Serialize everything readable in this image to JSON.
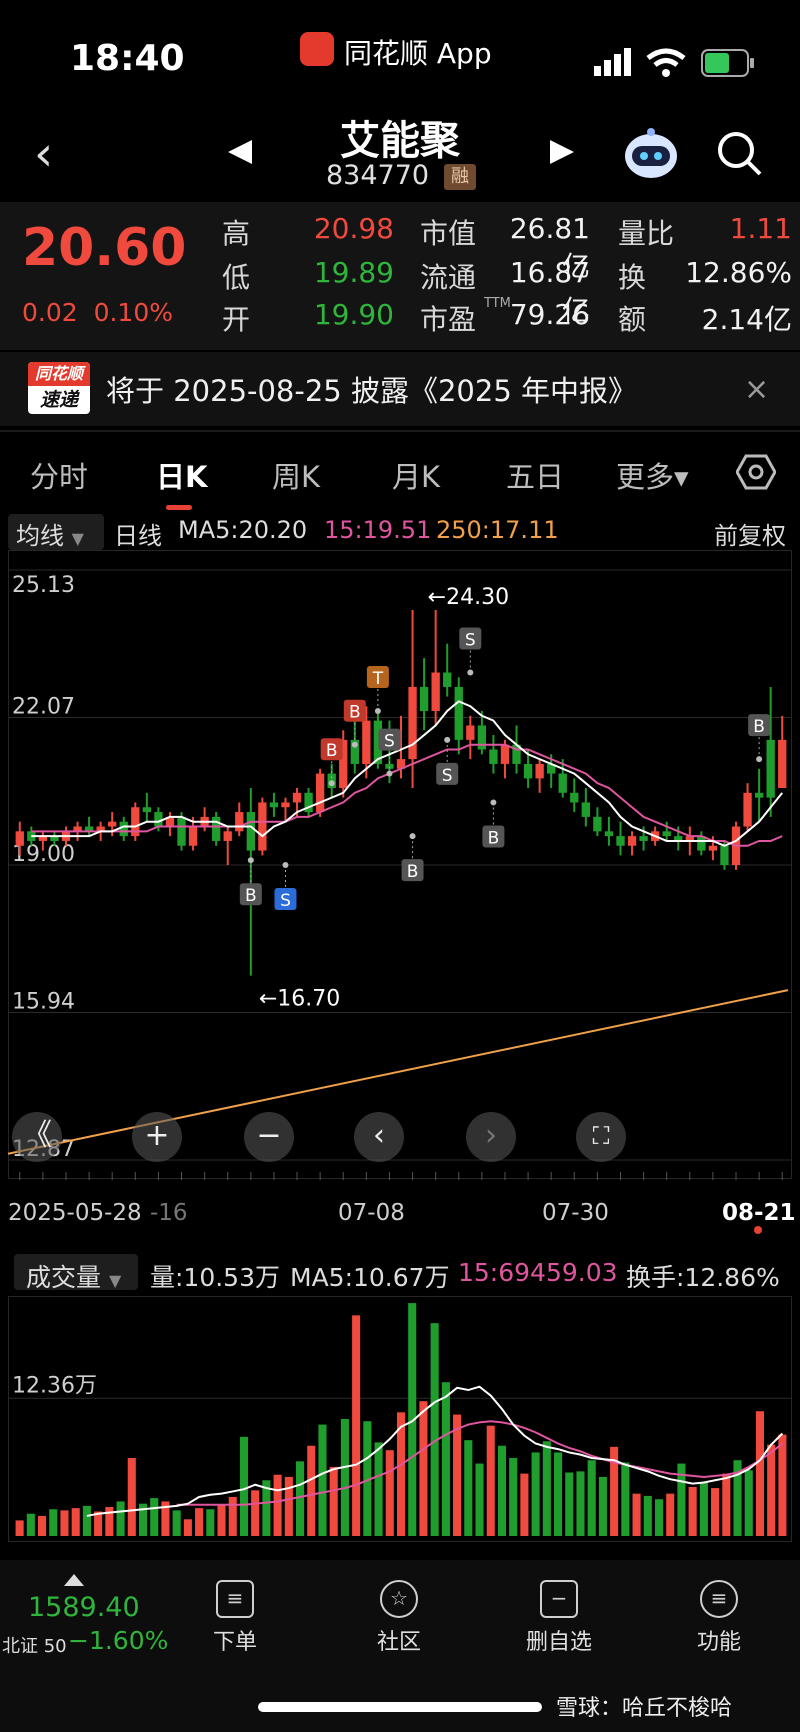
{
  "status_bar": {
    "time": "18:40",
    "app_label": "同花顺 App"
  },
  "header": {
    "name": "艾能聚",
    "code": "834770",
    "margin_badge": "融"
  },
  "quote": {
    "price": "20.60",
    "change": "0.02",
    "change_pct": "0.10%",
    "rows": [
      {
        "l1": "高",
        "v1": "20.98",
        "c1": "red",
        "l2": "市值",
        "v2": "26.81亿",
        "l3": "量比",
        "v3": "1.11",
        "c3": "red"
      },
      {
        "l1": "低",
        "v1": "19.89",
        "c1": "green",
        "l2": "流通",
        "v2": "16.87亿",
        "l3": "换",
        "v3": "12.86%",
        "c3": "white"
      },
      {
        "l1": "开",
        "v1": "19.90",
        "c1": "green",
        "l2": "市盈",
        "v2": "79.26",
        "l3": "额",
        "v3": "2.14亿",
        "c3": "white"
      }
    ],
    "pe_superscript": "TTM"
  },
  "notice": {
    "logo_top": "同花顺",
    "logo_bottom": "速递",
    "text": "将于 2025-08-25 披露《2025 年中报》",
    "close": "×"
  },
  "tabs": [
    "分时",
    "日K",
    "周K",
    "月K",
    "五日",
    "更多▾"
  ],
  "active_tab": "日K",
  "ma_bar": {
    "selector": "均线",
    "period": "日线",
    "ma5": "MA5:20.20",
    "ma15": "15:19.51",
    "ma250": "250:17.11",
    "adjust": "前复权"
  },
  "price_axis": [
    "25.13",
    "22.07",
    "19.00",
    "15.94",
    "12.87"
  ],
  "annotations": {
    "high": "←24.30",
    "low": "←16.70"
  },
  "dates": {
    "start": "2025-05-28",
    "partial": "-16",
    "d1": "07-08",
    "d2": "07-30",
    "end": "08-21"
  },
  "zoom_controls": [
    "《",
    "+",
    "−",
    "‹",
    "›",
    "⛶"
  ],
  "volume_bar": {
    "selector": "成交量",
    "vol": "量:10.53万",
    "ma5": "MA5:10.67万",
    "ma15": "15:69459.03",
    "turnover": "换手:12.86%"
  },
  "volume_axis": "12.36万",
  "colors": {
    "up": "#f04a3e",
    "down": "#1f9e2e",
    "ma5": "#ffffff",
    "ma15": "#e0559f",
    "ma250": "#f0a14a"
  },
  "chart_data": {
    "type": "candlestick",
    "ylim": [
      12.87,
      25.13
    ],
    "candles": [
      [
        19.4,
        19.9,
        19.2,
        19.7,
        "up"
      ],
      [
        19.7,
        19.8,
        19.4,
        19.5,
        "down"
      ],
      [
        19.5,
        19.7,
        19.3,
        19.6,
        "up"
      ],
      [
        19.6,
        19.7,
        19.4,
        19.5,
        "down"
      ],
      [
        19.5,
        19.8,
        19.4,
        19.7,
        "up"
      ],
      [
        19.7,
        19.9,
        19.5,
        19.8,
        "up"
      ],
      [
        19.8,
        20.0,
        19.6,
        19.7,
        "down"
      ],
      [
        19.7,
        19.9,
        19.5,
        19.8,
        "up"
      ],
      [
        19.8,
        20.1,
        19.6,
        19.9,
        "up"
      ],
      [
        19.9,
        20.0,
        19.5,
        19.6,
        "down"
      ],
      [
        19.6,
        20.3,
        19.5,
        20.2,
        "up"
      ],
      [
        20.2,
        20.5,
        19.9,
        20.1,
        "down"
      ],
      [
        20.1,
        20.2,
        19.7,
        19.8,
        "down"
      ],
      [
        19.8,
        20.1,
        19.6,
        20.0,
        "up"
      ],
      [
        20.0,
        20.1,
        19.3,
        19.4,
        "down"
      ],
      [
        19.4,
        20.0,
        19.3,
        19.8,
        "up"
      ],
      [
        19.8,
        20.2,
        19.7,
        20.0,
        "up"
      ],
      [
        20.0,
        20.1,
        19.4,
        19.5,
        "down"
      ],
      [
        19.5,
        19.8,
        19.0,
        19.7,
        "up"
      ],
      [
        19.7,
        20.3,
        19.6,
        20.1,
        "up"
      ],
      [
        20.1,
        20.6,
        16.7,
        19.3,
        "down"
      ],
      [
        19.3,
        20.4,
        19.2,
        20.3,
        "up"
      ],
      [
        20.3,
        20.5,
        20.0,
        20.2,
        "down"
      ],
      [
        20.2,
        20.4,
        19.9,
        20.3,
        "up"
      ],
      [
        20.3,
        20.6,
        20.0,
        20.5,
        "up"
      ],
      [
        20.5,
        20.6,
        20.0,
        20.1,
        "down"
      ],
      [
        20.1,
        21.0,
        20.0,
        20.9,
        "up"
      ],
      [
        20.9,
        21.1,
        20.4,
        20.6,
        "down"
      ],
      [
        20.6,
        21.8,
        20.4,
        21.6,
        "up"
      ],
      [
        21.6,
        22.4,
        20.9,
        21.1,
        "down"
      ],
      [
        21.1,
        22.3,
        20.8,
        22.0,
        "up"
      ],
      [
        22.0,
        22.2,
        21.0,
        21.1,
        "down"
      ],
      [
        21.1,
        22.0,
        20.7,
        21.0,
        "down"
      ],
      [
        21.0,
        22.1,
        20.8,
        21.2,
        "up"
      ],
      [
        21.2,
        24.3,
        20.6,
        22.7,
        "up"
      ],
      [
        22.7,
        23.3,
        21.8,
        22.2,
        "down"
      ],
      [
        22.2,
        24.3,
        21.9,
        23.0,
        "up"
      ],
      [
        23.0,
        23.6,
        22.5,
        22.7,
        "down"
      ],
      [
        22.7,
        22.9,
        21.3,
        21.6,
        "down"
      ],
      [
        21.6,
        22.1,
        21.2,
        21.9,
        "up"
      ],
      [
        21.9,
        22.2,
        21.3,
        21.4,
        "down"
      ],
      [
        21.4,
        21.7,
        20.9,
        21.1,
        "down"
      ],
      [
        21.1,
        21.6,
        20.8,
        21.5,
        "up"
      ],
      [
        21.5,
        21.9,
        20.9,
        21.1,
        "down"
      ],
      [
        21.1,
        21.4,
        20.6,
        20.8,
        "down"
      ],
      [
        20.8,
        21.2,
        20.5,
        21.1,
        "up"
      ],
      [
        21.1,
        21.3,
        20.6,
        20.9,
        "down"
      ],
      [
        20.9,
        21.2,
        20.4,
        20.5,
        "down"
      ],
      [
        20.5,
        20.8,
        20.1,
        20.3,
        "down"
      ],
      [
        20.3,
        20.6,
        19.8,
        20.0,
        "down"
      ],
      [
        20.0,
        20.2,
        19.6,
        19.7,
        "down"
      ],
      [
        19.7,
        20.0,
        19.4,
        19.6,
        "down"
      ],
      [
        19.6,
        19.9,
        19.2,
        19.4,
        "down"
      ],
      [
        19.4,
        19.7,
        19.2,
        19.6,
        "up"
      ],
      [
        19.6,
        19.8,
        19.3,
        19.5,
        "down"
      ],
      [
        19.5,
        19.8,
        19.4,
        19.7,
        "up"
      ],
      [
        19.7,
        19.9,
        19.5,
        19.6,
        "down"
      ],
      [
        19.6,
        19.8,
        19.3,
        19.5,
        "down"
      ],
      [
        19.5,
        19.8,
        19.2,
        19.6,
        "up"
      ],
      [
        19.6,
        19.7,
        19.2,
        19.3,
        "down"
      ],
      [
        19.3,
        19.6,
        19.1,
        19.4,
        "up"
      ],
      [
        19.4,
        19.5,
        18.9,
        19.0,
        "down"
      ],
      [
        19.0,
        19.9,
        18.9,
        19.8,
        "up"
      ],
      [
        19.8,
        20.7,
        19.7,
        20.5,
        "up"
      ],
      [
        20.5,
        21.0,
        19.9,
        20.4,
        "down"
      ],
      [
        20.4,
        22.7,
        20.0,
        21.6,
        "down"
      ],
      [
        21.6,
        22.1,
        20.7,
        20.6,
        "up"
      ]
    ],
    "ma5": [
      19.6,
      19.6,
      19.6,
      19.6,
      19.6,
      19.6,
      19.7,
      19.7,
      19.8,
      19.8,
      19.9,
      19.9,
      20.0,
      20.0,
      19.9,
      19.9,
      19.9,
      19.8,
      19.8,
      19.8,
      19.6,
      19.8,
      19.9,
      20.1,
      20.2,
      20.3,
      20.4,
      20.5,
      20.8,
      21.0,
      21.2,
      21.3,
      21.4,
      21.5,
      21.7,
      21.9,
      22.2,
      22.4,
      22.3,
      22.1,
      22.0,
      21.7,
      21.5,
      21.3,
      21.2,
      21.1,
      21.0,
      20.9,
      20.7,
      20.5,
      20.3,
      20.0,
      19.8,
      19.7,
      19.6,
      19.5,
      19.5,
      19.5,
      19.5,
      19.5,
      19.4,
      19.5,
      19.7,
      19.9,
      20.2,
      20.5
    ],
    "ma15": [
      19.7,
      19.7,
      19.7,
      19.7,
      19.7,
      19.7,
      19.7,
      19.7,
      19.7,
      19.7,
      19.7,
      19.8,
      19.8,
      19.8,
      19.8,
      19.8,
      19.8,
      19.8,
      19.8,
      19.9,
      19.9,
      19.9,
      19.9,
      20.0,
      20.0,
      20.1,
      20.2,
      20.3,
      20.5,
      20.6,
      20.8,
      20.9,
      21.0,
      21.1,
      21.2,
      21.3,
      21.4,
      21.4,
      21.5,
      21.5,
      21.5,
      21.5,
      21.4,
      21.4,
      21.3,
      21.2,
      21.1,
      21.0,
      20.9,
      20.7,
      20.6,
      20.4,
      20.2,
      20.0,
      19.9,
      19.8,
      19.7,
      19.6,
      19.6,
      19.5,
      19.5,
      19.4,
      19.4,
      19.5,
      19.5,
      19.6
    ],
    "ma250": [
      13.0,
      16.4
    ],
    "volume_ylim": [
      0,
      21
    ],
    "volumes": [
      1.4,
      2.0,
      1.8,
      2.4,
      2.3,
      2.5,
      2.7,
      2.2,
      2.6,
      3.1,
      7.0,
      2.9,
      3.4,
      3.1,
      2.3,
      1.5,
      2.5,
      2.4,
      2.8,
      3.5,
      8.9,
      4.1,
      5.0,
      5.5,
      5.3,
      6.7,
      8.1,
      10.0,
      6.2,
      10.5,
      19.8,
      10.3,
      8.4,
      7.7,
      11.1,
      20.9,
      12.1,
      19.1,
      13.8,
      10.9,
      8.6,
      6.5,
      9.9,
      8.1,
      7.0,
      5.6,
      7.5,
      8.5,
      7.5,
      5.7,
      5.8,
      6.8,
      5.3,
      8.0,
      6.6,
      3.8,
      3.6,
      3.3,
      3.8,
      6.5,
      4.4,
      4.8,
      4.3,
      5.6,
      6.8,
      5.9,
      11.2,
      8.2,
      9.1
    ],
    "vol_ma5": [
      1.8,
      2.0,
      2.1,
      2.2,
      2.3,
      2.4,
      2.5,
      2.6,
      2.7,
      2.9,
      3.5,
      3.7,
      3.8,
      4.0,
      4.2,
      4.6,
      4.3,
      4.1,
      4.3,
      4.6,
      5.1,
      5.6,
      6.0,
      6.2,
      6.4,
      7.0,
      7.8,
      8.7,
      9.8,
      10.3,
      11.2,
      12.0,
      12.5,
      13.3,
      13.1,
      13.4,
      12.6,
      11.4,
      10.0,
      9.0,
      8.3,
      8.0,
      7.8,
      7.5,
      7.3,
      7.0,
      6.9,
      6.8,
      6.4,
      6.1,
      5.8,
      5.4,
      5.1,
      4.9,
      4.7,
      4.8,
      5.0,
      5.2,
      5.5,
      6.0,
      6.8,
      8.2,
      9.2
    ],
    "vol_ma15": [
      2.8,
      2.8,
      2.8,
      2.8,
      2.8,
      2.8,
      2.8,
      2.9,
      3.0,
      3.1,
      3.3,
      3.5,
      3.7,
      3.9,
      4.1,
      4.3,
      4.6,
      5.0,
      5.4,
      5.8,
      6.4,
      7.1,
      7.8,
      8.5,
      9.1,
      9.6,
      10.0,
      10.2,
      10.3,
      10.2,
      10.0,
      9.7,
      9.3,
      8.8,
      8.3,
      7.9,
      7.6,
      7.2,
      6.9,
      6.6,
      6.4,
      6.2,
      6.0,
      5.8,
      5.6,
      5.5,
      5.4,
      5.3,
      5.4,
      5.5,
      5.7,
      6.2,
      6.8,
      7.5,
      8.3
    ]
  },
  "bottom_nav": {
    "index_value": "1589.40",
    "index_name": "北证 50",
    "index_change": "−1.60%",
    "items": [
      "下单",
      "社区",
      "删自选",
      "功能"
    ]
  },
  "watermark": "雪球：哈丘不梭哈"
}
